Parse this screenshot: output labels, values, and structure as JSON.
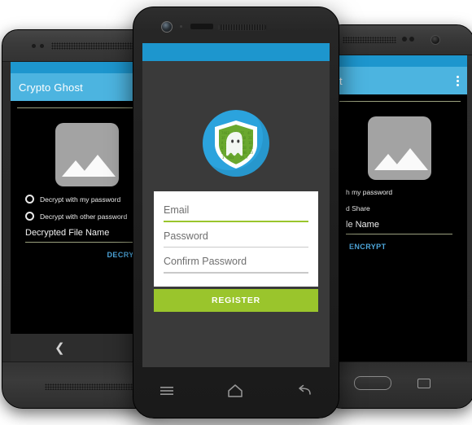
{
  "scene": {
    "description": "Three Android phones showing the Crypto Ghost app",
    "colors": {
      "status_blue": "#1d96ce",
      "appbar_blue": "#4cb4e0",
      "accent_green": "#9ac52c",
      "link_blue": "#4ea8dd",
      "screen_dark": "#3a3a3a",
      "screen_black": "#000000"
    }
  },
  "left_phone": {
    "device": "htc-style-phone",
    "appbar": {
      "title": "Crypto Ghost"
    },
    "thumbnail": {
      "icon": "image-placeholder-icon"
    },
    "options": [
      {
        "label": "Decrypt with my password",
        "selected": false
      },
      {
        "label": "Decrypt with other password",
        "selected": false
      }
    ],
    "filename_field": {
      "label": "Decrypted File Name",
      "value": "Decrypted File Name"
    },
    "action_button": {
      "label": "DECRYPT"
    },
    "navigation": {
      "back_icon": "back-chevron-icon"
    }
  },
  "center_phone": {
    "device": "oneplus-style-phone",
    "logo": {
      "icon": "ghost-shield-logo",
      "circle_color": "#2ba3dd",
      "shield_color": "#6aa82e"
    },
    "form": {
      "fields": [
        {
          "placeholder": "Email",
          "value": "",
          "focused": true
        },
        {
          "placeholder": "Password",
          "value": "",
          "focused": false
        },
        {
          "placeholder": "Confirm Password",
          "value": "",
          "focused": false
        }
      ]
    },
    "submit_button": {
      "label": "REGISTER"
    },
    "navigation": {
      "menu_icon": "hamburger-menu-icon",
      "home_icon": "home-icon",
      "back_icon": "back-arrow-icon"
    }
  },
  "right_phone": {
    "device": "samsung-style-phone",
    "appbar": {
      "title": "t",
      "overflow_icon": "overflow-menu-icon"
    },
    "thumbnail": {
      "icon": "image-placeholder-icon"
    },
    "options": [
      {
        "label": "h my password",
        "selected": false
      },
      {
        "label": "d Share",
        "selected": false
      }
    ],
    "filename_field": {
      "label": "le Name",
      "value": "le Name"
    },
    "action_button": {
      "label": "ENCRYPT"
    },
    "navigation": {
      "home_key": "home-button",
      "recents_key": "recents-key-icon"
    }
  }
}
